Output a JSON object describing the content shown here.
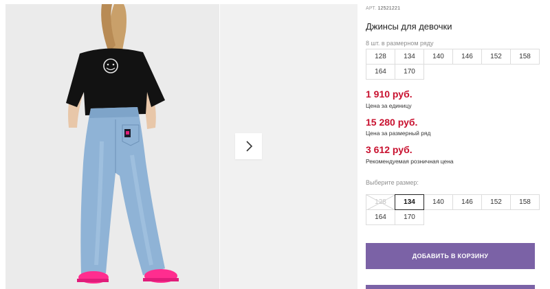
{
  "gallery": {
    "photo_alt": "",
    "next_icon": "chevron-right-icon"
  },
  "product": {
    "art_label": "АРТ.",
    "art_number": "12521221",
    "title": "Джинсы для девочки",
    "row_note": "8 шт. в размерном ряду",
    "size_row": [
      "128",
      "134",
      "140",
      "146",
      "152",
      "158",
      "164",
      "170"
    ],
    "prices": {
      "unit_price": "1 910 руб.",
      "unit_label": "Цена за единицу",
      "row_price": "15 280 руб.",
      "row_label": "Цена за размерный ряд",
      "retail_price": "3 612 руб.",
      "retail_label": "Рекомендуемая розничная цена"
    },
    "choose_label": "Выберите размер:",
    "size_options": [
      {
        "label": "128",
        "state": "disabled"
      },
      {
        "label": "134",
        "state": "selected"
      },
      {
        "label": "140",
        "state": "available"
      },
      {
        "label": "146",
        "state": "available"
      },
      {
        "label": "152",
        "state": "available"
      },
      {
        "label": "158",
        "state": "available"
      },
      {
        "label": "164",
        "state": "available"
      },
      {
        "label": "170",
        "state": "available"
      }
    ],
    "add_to_cart": "ДОБАВИТЬ В КОРЗИНУ"
  },
  "colors": {
    "price_red": "#c8102e",
    "button_purple": "#7b62a6",
    "photo_bg": "#ececec"
  }
}
